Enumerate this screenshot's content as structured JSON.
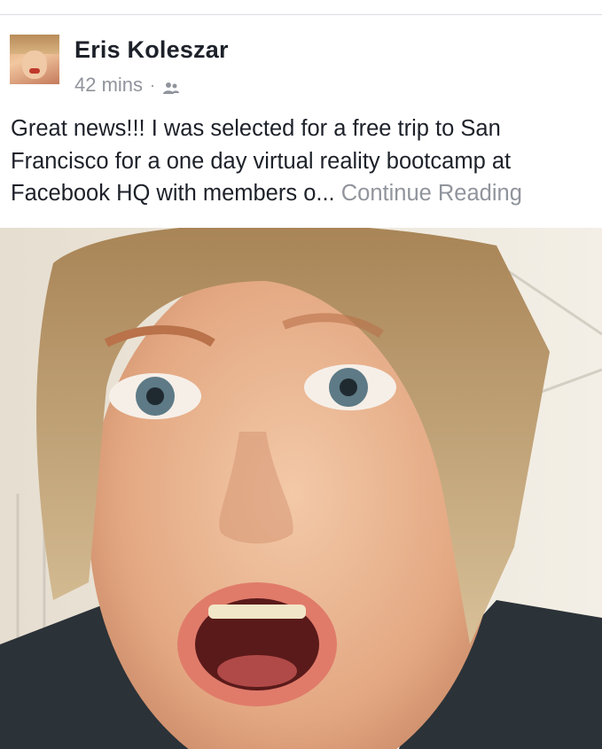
{
  "post": {
    "author": "Eris Koleszar",
    "timestamp": "42 mins",
    "separator": "·",
    "privacy_icon": "friends-icon",
    "text_lines": [
      "Great news!!! I was selected for a free trip to San",
      "Francisco for a one day virtual reality bootcamp at",
      "Facebook HQ with members o..."
    ],
    "continue_label": "Continue Reading",
    "photo_icon": "selfie-photo"
  },
  "colors": {
    "name": "#1d2129",
    "meta": "#90949c",
    "divider": "#dcdee3"
  }
}
